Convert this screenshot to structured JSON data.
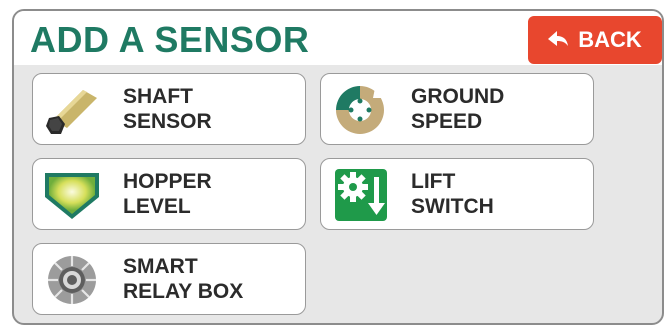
{
  "header": {
    "title": "ADD A SENSOR",
    "back_label": "BACK"
  },
  "tiles": [
    {
      "line1": "SHAFT",
      "line2": "SENSOR",
      "icon": "shaft-sensor-icon"
    },
    {
      "line1": "GROUND",
      "line2": "SPEED",
      "icon": "ground-speed-icon"
    },
    {
      "line1": "HOPPER",
      "line2": "LEVEL",
      "icon": "hopper-level-icon"
    },
    {
      "line1": "LIFT",
      "line2": "SWITCH",
      "icon": "lift-switch-icon"
    },
    {
      "line1": "SMART",
      "line2": "RELAY BOX",
      "icon": "smart-relay-box-icon"
    }
  ],
  "colors": {
    "title": "#1f7a63",
    "back": "#e8472e",
    "panel": "#e7e7e7"
  }
}
